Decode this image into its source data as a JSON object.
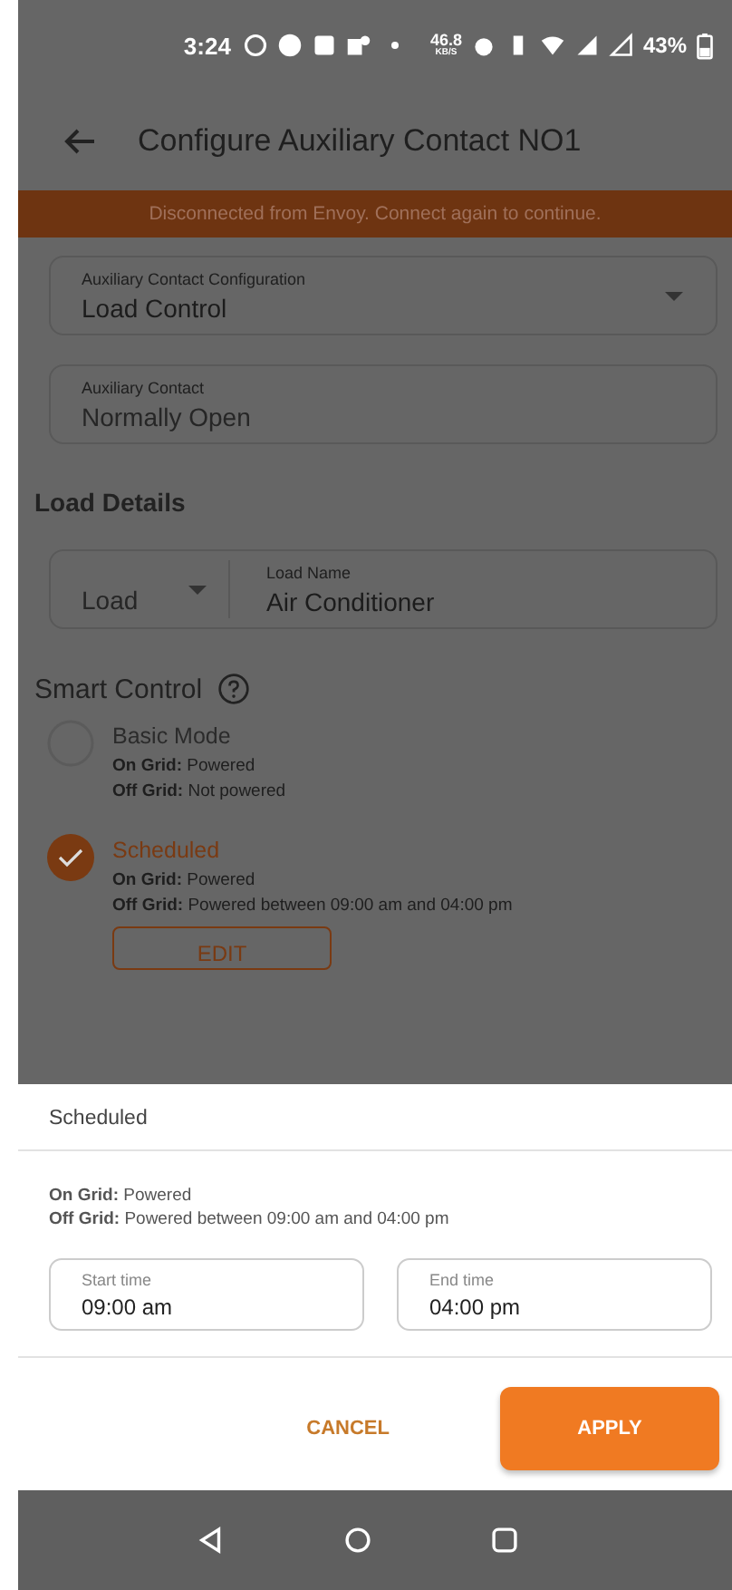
{
  "status_bar": {
    "time": "3:24",
    "speed": "46.8",
    "speed_unit": "KB/S",
    "battery": "43%"
  },
  "app_bar": {
    "title": "Configure Auxiliary Contact NO1"
  },
  "banner": {
    "text": "Disconnected from Envoy. Connect again to continue."
  },
  "fields": [
    {
      "label": "Auxiliary Contact Configuration",
      "value": "Load Control",
      "kind": "dropdown"
    },
    {
      "label": "Auxiliary Contact",
      "value": "Normally Open",
      "kind": "readonly"
    }
  ],
  "load_details": {
    "heading": "Load Details",
    "type_value": "Load",
    "name_label": "Load Name",
    "name_value": "Air Conditioner"
  },
  "smart_control": {
    "heading": "Smart Control",
    "options": [
      {
        "title": "Basic Mode",
        "lines": [
          "**On Grid:** Powered",
          "**Off Grid:** Not powered"
        ],
        "selected": false
      },
      {
        "title": "Scheduled",
        "lines": [
          "**On Grid:** Powered",
          "**Off Grid:** Powered between 09:00 am and 04:00 pm"
        ],
        "selected": true
      }
    ],
    "edit_button": "EDIT"
  },
  "sheet": {
    "title": "Scheduled",
    "lines": [
      "**On Grid:** Powered",
      "**Off Grid:** Powered between 09:00 am and 04:00 pm"
    ],
    "times": [
      {
        "label": "Start time",
        "value": "09:00 am"
      },
      {
        "label": "End time",
        "value": "04:00 pm"
      }
    ],
    "cancel": "CANCEL",
    "apply": "APPLY"
  }
}
